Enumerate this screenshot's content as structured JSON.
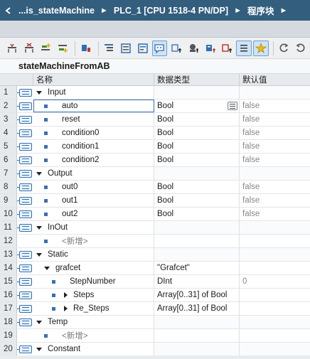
{
  "breadcrumb": {
    "project": "...is_stateMachine",
    "device": "PLC_1 [CPU 1518-4 PN/DP]",
    "folder": "程序块",
    "separator": "►"
  },
  "block": {
    "name": "stateMachineFromAB"
  },
  "columns": {
    "name": "名称",
    "type": "数据类型",
    "default": "默认值"
  },
  "toolbar": {
    "icons": [
      "insert-row-icon",
      "delete-row-icon",
      "add-row-icon",
      "add-below-icon",
      "monitor-icon",
      "expand-all-icon",
      "collapse-all-icon",
      "show-comments-icon",
      "show-hmi-icon",
      "settings-icon",
      "retain-icon",
      "setpoint-icon",
      "plc-tag-icon",
      "list-icon",
      "snapshot-icon",
      "copy-snapshot-icon",
      "load-snapshot-icon"
    ]
  },
  "rows": [
    {
      "num": "1",
      "name": "Input",
      "type": "",
      "default": "",
      "level": 0,
      "kind": "section"
    },
    {
      "num": "2",
      "name": "auto",
      "type": "Bool",
      "default": "false",
      "level": 1,
      "kind": "var",
      "selected": true
    },
    {
      "num": "3",
      "name": "reset",
      "type": "Bool",
      "default": "false",
      "level": 1,
      "kind": "var"
    },
    {
      "num": "4",
      "name": "condition0",
      "type": "Bool",
      "default": "false",
      "level": 1,
      "kind": "var"
    },
    {
      "num": "5",
      "name": "condition1",
      "type": "Bool",
      "default": "false",
      "level": 1,
      "kind": "var"
    },
    {
      "num": "6",
      "name": "condition2",
      "type": "Bool",
      "default": "false",
      "level": 1,
      "kind": "var"
    },
    {
      "num": "7",
      "name": "Output",
      "type": "",
      "default": "",
      "level": 0,
      "kind": "section"
    },
    {
      "num": "8",
      "name": "out0",
      "type": "Bool",
      "default": "false",
      "level": 1,
      "kind": "var"
    },
    {
      "num": "9",
      "name": "out1",
      "type": "Bool",
      "default": "false",
      "level": 1,
      "kind": "var"
    },
    {
      "num": "10",
      "name": "out2",
      "type": "Bool",
      "default": "false",
      "level": 1,
      "kind": "var"
    },
    {
      "num": "11",
      "name": "InOut",
      "type": "",
      "default": "",
      "level": 0,
      "kind": "section"
    },
    {
      "num": "12",
      "name": "<新增>",
      "type": "",
      "default": "",
      "level": 1,
      "kind": "placeholder"
    },
    {
      "num": "13",
      "name": "Static",
      "type": "",
      "default": "",
      "level": 0,
      "kind": "section"
    },
    {
      "num": "14",
      "name": "grafcet",
      "type": "\"Grafcet\"",
      "default": "",
      "level": 1,
      "kind": "struct-open"
    },
    {
      "num": "15",
      "name": "StepNumber",
      "type": "DInt",
      "default": "0",
      "level": 2,
      "kind": "var"
    },
    {
      "num": "16",
      "name": "Steps",
      "type": "Array[0..31] of Bool",
      "default": "",
      "level": 2,
      "kind": "struct-closed"
    },
    {
      "num": "17",
      "name": "Re_Steps",
      "type": "Array[0..31] of Bool",
      "default": "",
      "level": 2,
      "kind": "struct-closed"
    },
    {
      "num": "18",
      "name": "Temp",
      "type": "",
      "default": "",
      "level": 0,
      "kind": "section"
    },
    {
      "num": "19",
      "name": "<新增>",
      "type": "",
      "default": "",
      "level": 1,
      "kind": "placeholder"
    },
    {
      "num": "20",
      "name": "Constant",
      "type": "",
      "default": "",
      "level": 0,
      "kind": "section"
    }
  ],
  "colors": {
    "titlebar": "#335e7d",
    "accent": "#2f6fb0"
  }
}
